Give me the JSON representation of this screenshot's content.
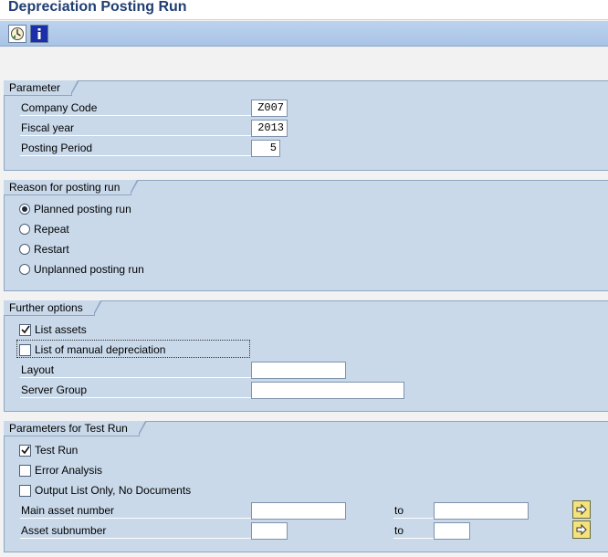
{
  "page": {
    "title": "Depreciation Posting Run"
  },
  "toolbar": {
    "execute_icon": "execute-icon",
    "info_icon": "info-icon"
  },
  "parameter": {
    "title": "Parameter",
    "company_code": {
      "label": "Company Code",
      "value": "Z007"
    },
    "fiscal_year": {
      "label": "Fiscal year",
      "value": "2013"
    },
    "posting_period": {
      "label": "Posting Period",
      "value": "5"
    }
  },
  "reason": {
    "title": "Reason for posting run",
    "options": [
      {
        "label": "Planned posting run",
        "selected": true
      },
      {
        "label": "Repeat",
        "selected": false
      },
      {
        "label": "Restart",
        "selected": false
      },
      {
        "label": "Unplanned posting run",
        "selected": false
      }
    ]
  },
  "further": {
    "title": "Further options",
    "list_assets": {
      "label": "List assets",
      "checked": true
    },
    "list_manual": {
      "label": "List of manual depreciation",
      "checked": false
    },
    "layout": {
      "label": "Layout",
      "value": ""
    },
    "server_group": {
      "label": "Server Group",
      "value": ""
    }
  },
  "test_run": {
    "title": "Parameters for Test Run",
    "test_run": {
      "label": "Test Run",
      "checked": true
    },
    "error_analysis": {
      "label": "Error Analysis",
      "checked": false
    },
    "output_list": {
      "label": "Output List Only, No Documents",
      "checked": false
    },
    "main_asset": {
      "label": "Main asset number",
      "from": "",
      "to_label": "to",
      "to": ""
    },
    "asset_sub": {
      "label": "Asset subnumber",
      "from": "",
      "to_label": "to",
      "to": ""
    }
  },
  "colors": {
    "group_bg": "#c9d9ea",
    "title_color": "#1f3f73",
    "toolbar_bg": "#a9c3e6"
  }
}
